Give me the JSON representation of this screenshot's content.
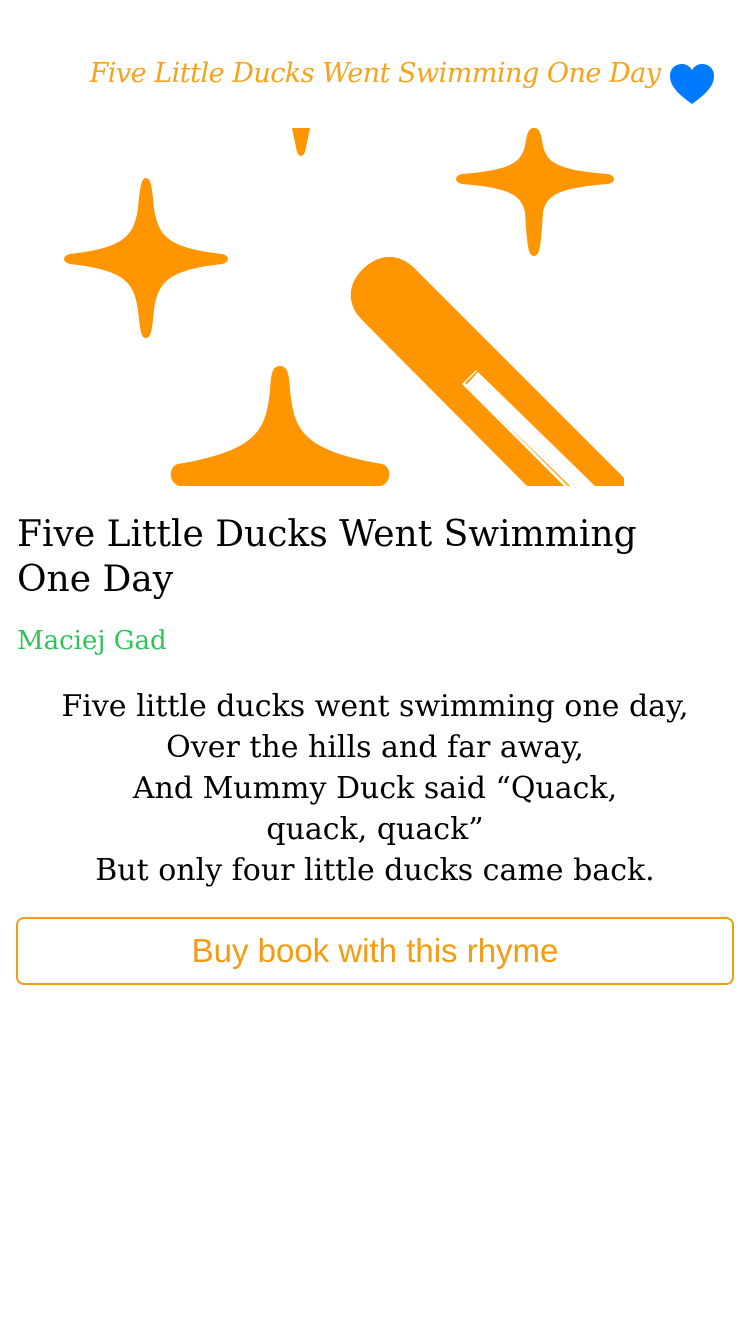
{
  "nav": {
    "title": "Five Little Ducks Went Swimming One Day",
    "favorite_icon": "heart-icon"
  },
  "hero": {
    "icon": "magic-wand-sparkles-icon"
  },
  "rhyme": {
    "title": "Five Little Ducks Went Swimming One Day",
    "author": "Maciej Gad",
    "lines": [
      "Five little ducks went swimming one day,",
      "Over the hills and far away,",
      "And Mummy Duck said “Quack,",
      "quack, quack”",
      "But only four little ducks came back."
    ]
  },
  "buy_button": {
    "label": "Buy book with this rhyme"
  },
  "colors": {
    "accent": "#f7a21b",
    "hero_orange": "#ff9500",
    "author_green": "#2ec35a",
    "favorite_blue": "#007aff",
    "button_border": "#f39c12"
  }
}
